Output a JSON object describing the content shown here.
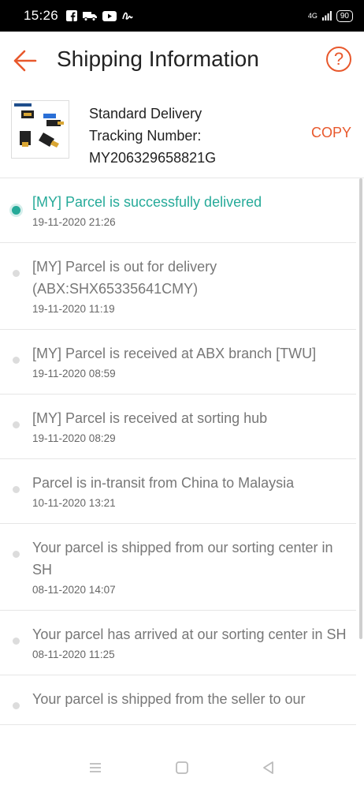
{
  "status": {
    "time": "15:26",
    "network": "4G",
    "battery": "90"
  },
  "header": {
    "title": "Shipping Information"
  },
  "shipment": {
    "method": "Standard Delivery",
    "tracking_label": "Tracking Number:",
    "tracking_number": "MY206329658821G",
    "copy_label": "COPY"
  },
  "events": [
    {
      "text": "[MY] Parcel is successfully delivered",
      "time": "19-11-2020 21:26"
    },
    {
      "text": "[MY] Parcel is out for delivery (ABX:SHX65335641CMY)",
      "time": "19-11-2020 11:19"
    },
    {
      "text": "[MY] Parcel is received at ABX branch [TWU]",
      "time": "19-11-2020 08:59"
    },
    {
      "text": "[MY] Parcel is received at sorting hub",
      "time": "19-11-2020 08:29"
    },
    {
      "text": "Parcel is in-transit from China to Malaysia",
      "time": "10-11-2020 13:21"
    },
    {
      "text": "Your parcel is shipped from our sorting center in SH",
      "time": "08-11-2020 14:07"
    },
    {
      "text": "Your parcel has arrived at our sorting center in SH",
      "time": "08-11-2020 11:25"
    },
    {
      "text": "Your parcel is shipped from the seller to our"
    }
  ],
  "colors": {
    "accent": "#e8582c",
    "active": "#26aa99"
  },
  "icons": [
    "back-arrow-icon",
    "help-icon",
    "menu-icon",
    "home-icon",
    "back-triangle-icon"
  ]
}
